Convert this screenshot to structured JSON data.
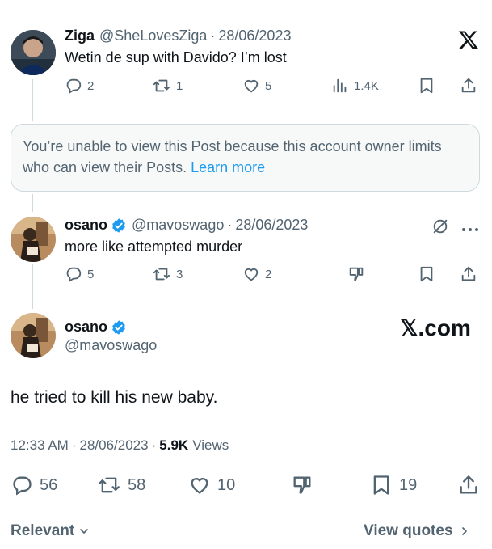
{
  "tweet1": {
    "name": "Ziga",
    "handle": "@SheLovesZiga",
    "date": "28/06/2023",
    "text": "Wetin de sup with Davido? I’m lost",
    "replies": "2",
    "retweets": "1",
    "likes": "5",
    "views": "1.4K"
  },
  "notice": {
    "text": "You’re unable to view this Post because this account owner limits who can view their Posts.",
    "link": "Learn more"
  },
  "tweet2": {
    "name": "osano",
    "handle": "@mavoswago",
    "date": "28/06/2023",
    "text": "more like attempted murder",
    "replies": "5",
    "retweets": "3",
    "likes": "2"
  },
  "main": {
    "name": "osano",
    "handle": "@mavoswago",
    "text": "he tried to kill his new baby.",
    "time": "12:33 AM",
    "date": "28/06/2023",
    "views_count": "5.9K",
    "views_label": "Views",
    "replies": "56",
    "retweets": "58",
    "likes": "10",
    "bookmarks": "19"
  },
  "watermark": "𝕏.com",
  "footer": {
    "sort": "Relevant",
    "quotes": "View quotes"
  },
  "colors": {
    "accent": "#1d9bf0",
    "muted": "#536471",
    "text": "#0f1419"
  }
}
